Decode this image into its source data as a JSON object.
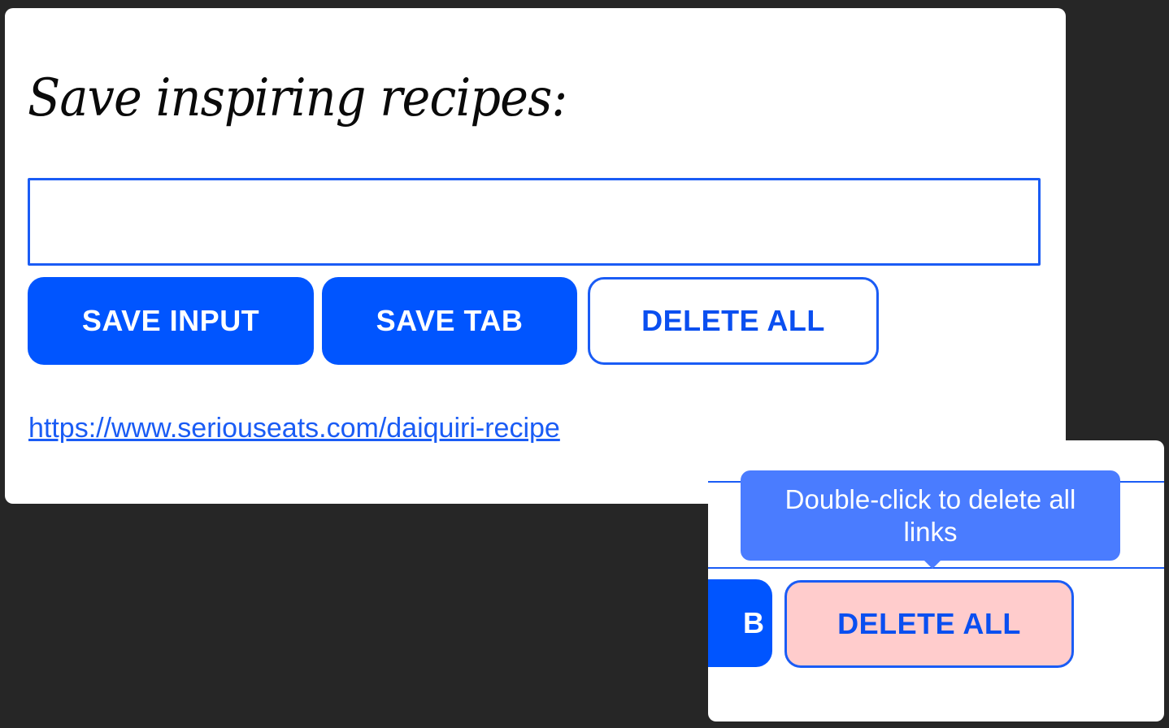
{
  "main": {
    "heading": "Save inspiring recipes:",
    "input": {
      "value": "",
      "placeholder": ""
    },
    "buttons": {
      "save_input": "SAVE INPUT",
      "save_tab": "SAVE TAB",
      "delete_all": "DELETE ALL"
    },
    "links": [
      "https://www.seriouseats.com/daiquiri-recipe"
    ]
  },
  "zoom_inset": {
    "tooltip": "Double-click to delete all links",
    "save_tab_partial": "B",
    "delete_all": "DELETE ALL"
  },
  "colors": {
    "page_background": "#262626",
    "panel_background": "#ffffff",
    "primary_blue": "#0055ff",
    "outline_blue": "#1a5cf5",
    "tooltip_blue": "#4a7cff",
    "delete_hover_pink": "#ffcccc"
  }
}
